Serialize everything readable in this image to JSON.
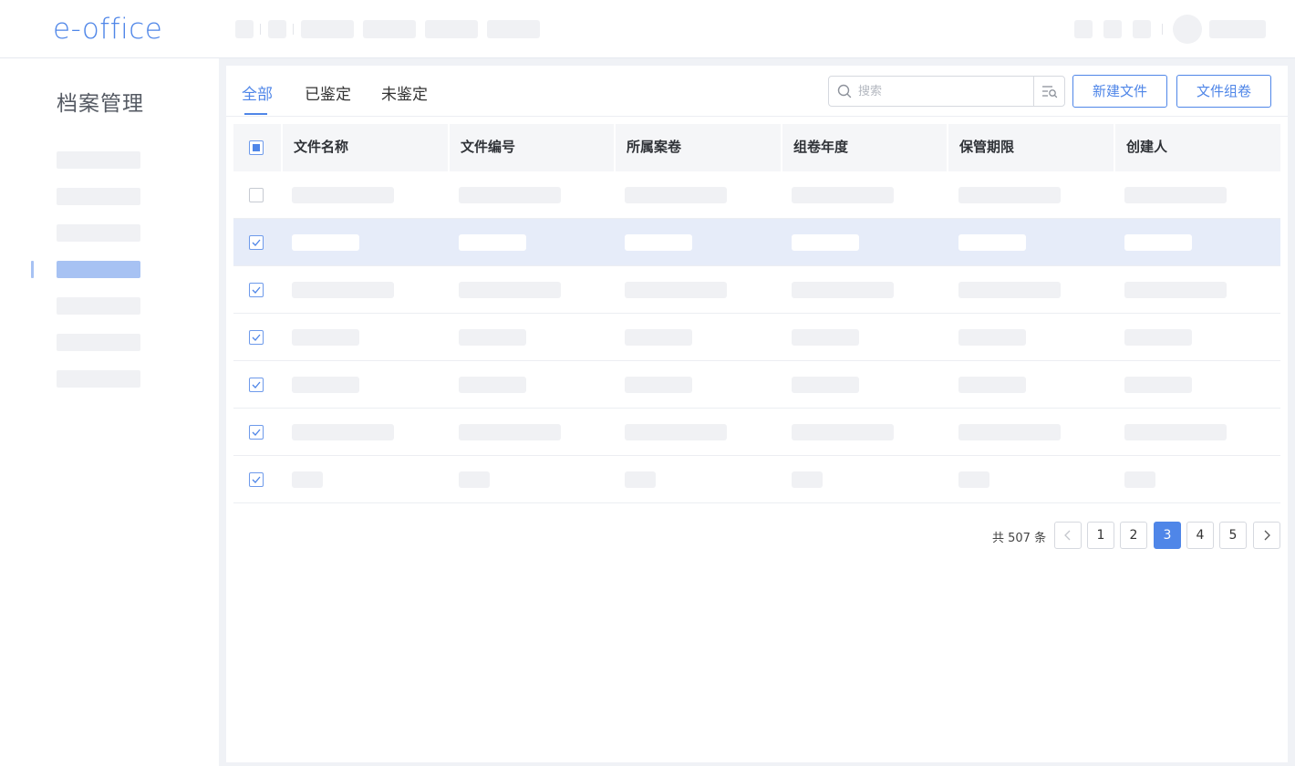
{
  "app": {
    "logo": "e-office"
  },
  "sidebar": {
    "title": "档案管理",
    "active_index": 3
  },
  "tabs": [
    {
      "label": "全部",
      "active": true
    },
    {
      "label": "已鉴定",
      "active": false
    },
    {
      "label": "未鉴定",
      "active": false
    }
  ],
  "search": {
    "placeholder": "搜索",
    "value": ""
  },
  "toolbar": {
    "new_file_label": "新建文件",
    "group_volume_label": "文件组卷"
  },
  "table": {
    "columns": [
      "文件名称",
      "文件编号",
      "所属案卷",
      "组卷年度",
      "保管期限",
      "创建人"
    ],
    "header_checkbox": "partial",
    "rows": [
      {
        "checked": false,
        "selected": false
      },
      {
        "checked": true,
        "selected": true
      },
      {
        "checked": true,
        "selected": false
      },
      {
        "checked": true,
        "selected": false
      },
      {
        "checked": true,
        "selected": false
      },
      {
        "checked": true,
        "selected": false
      },
      {
        "checked": true,
        "selected": false
      }
    ]
  },
  "pagination": {
    "total_text": "共 507 条",
    "pages": [
      "1",
      "2",
      "3",
      "4",
      "5"
    ],
    "current": "3"
  },
  "colors": {
    "accent": "#4f86e8",
    "selected_row": "#e6ecf9",
    "skeleton": "#f0f1f4"
  }
}
